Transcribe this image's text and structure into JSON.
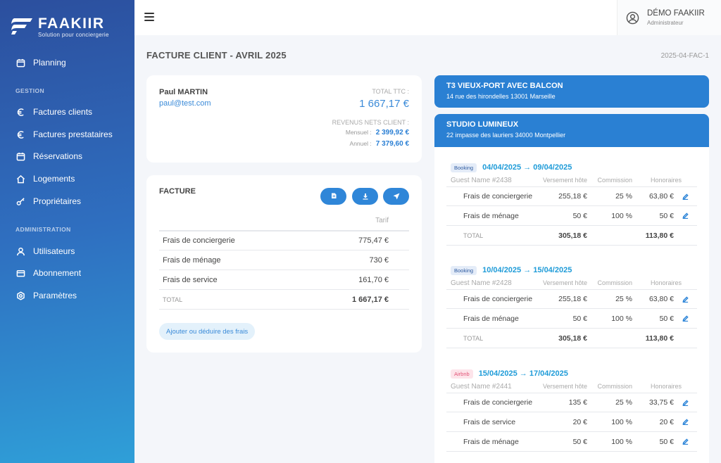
{
  "brand": {
    "name": "FAAKIIR",
    "tagline": "Solution pour conciergerie"
  },
  "sidebar": {
    "top_item": {
      "label": "Planning",
      "icon": "calendar-icon"
    },
    "section_gestion": "GESTION",
    "gestion_items": [
      {
        "label": "Factures clients",
        "icon": "euro-icon"
      },
      {
        "label": "Factures prestataires",
        "icon": "euro-icon"
      },
      {
        "label": "Réservations",
        "icon": "calendar-icon"
      },
      {
        "label": "Logements",
        "icon": "home-icon"
      },
      {
        "label": "Propriétaires",
        "icon": "key-icon"
      }
    ],
    "section_admin": "ADMINISTRATION",
    "admin_items": [
      {
        "label": "Utilisateurs",
        "icon": "user-icon"
      },
      {
        "label": "Abonnement",
        "icon": "credit-card-icon"
      },
      {
        "label": "Paramètres",
        "icon": "gear-icon"
      }
    ]
  },
  "header": {
    "user_name": "DÉMO FAAKIIR",
    "user_role": "Administrateur"
  },
  "page": {
    "title": "FACTURE CLIENT - AVRIL 2025",
    "reference": "2025-04-FAC-1"
  },
  "client": {
    "name": "Paul MARTIN",
    "email": "paul@test.com",
    "total_label": "TOTAL TTC :",
    "total_value": "1 667,17 €",
    "revenue_label": "REVENUS NETS CLIENT :",
    "monthly_label": "Mensuel :",
    "monthly_value": "2 399,92 €",
    "annual_label": "Annuel :",
    "annual_value": "7 379,60 €"
  },
  "facture": {
    "title": "FACTURE",
    "actions": [
      "copy-icon",
      "download-icon",
      "send-icon"
    ],
    "col_tarif": "Tarif",
    "rows": [
      {
        "name": "Frais de conciergerie",
        "value": "775,47 €"
      },
      {
        "name": "Frais de ménage",
        "value": "730 €"
      },
      {
        "name": "Frais de service",
        "value": "161,70 €"
      }
    ],
    "total_label": "TOTAL",
    "total_value": "1 667,17 €",
    "add_label": "Ajouter ou déduire des frais"
  },
  "properties": [
    {
      "title": "T3 VIEUX-PORT AVEC BALCON",
      "address": "14 rue des hirondelles 13001 Marseille"
    },
    {
      "title": "STUDIO LUMINEUX",
      "address": "22 impasse des lauriers 34000 Montpellier"
    }
  ],
  "booking_columns": {
    "versement": "Versement hôte",
    "commission": "Commission",
    "honoraires": "Honoraires"
  },
  "bookings": [
    {
      "source": "Booking",
      "dates": "04/04/2025 → 09/04/2025",
      "guest": "Guest Name #2438",
      "rows": [
        {
          "name": "Frais de conciergerie",
          "versement": "255,18 €",
          "commission": "25 %",
          "honoraires": "63,80 €"
        },
        {
          "name": "Frais de ménage",
          "versement": "50 €",
          "commission": "100 %",
          "honoraires": "50 €"
        }
      ],
      "total_label": "TOTAL",
      "total_versement": "305,18 €",
      "total_honoraires": "113,80 €"
    },
    {
      "source": "Booking",
      "dates": "10/04/2025 → 15/04/2025",
      "guest": "Guest Name #2428",
      "rows": [
        {
          "name": "Frais de conciergerie",
          "versement": "255,18 €",
          "commission": "25 %",
          "honoraires": "63,80 €"
        },
        {
          "name": "Frais de ménage",
          "versement": "50 €",
          "commission": "100 %",
          "honoraires": "50 €"
        }
      ],
      "total_label": "TOTAL",
      "total_versement": "305,18 €",
      "total_honoraires": "113,80 €"
    },
    {
      "source": "Airbnb",
      "dates": "15/04/2025 → 17/04/2025",
      "guest": "Guest Name #2441",
      "rows": [
        {
          "name": "Frais de conciergerie",
          "versement": "135 €",
          "commission": "25 %",
          "honoraires": "33,75 €"
        },
        {
          "name": "Frais de service",
          "versement": "20 €",
          "commission": "100 %",
          "honoraires": "20 €"
        },
        {
          "name": "Frais de ménage",
          "versement": "50 €",
          "commission": "100 %",
          "honoraires": "50 €"
        }
      ]
    }
  ]
}
